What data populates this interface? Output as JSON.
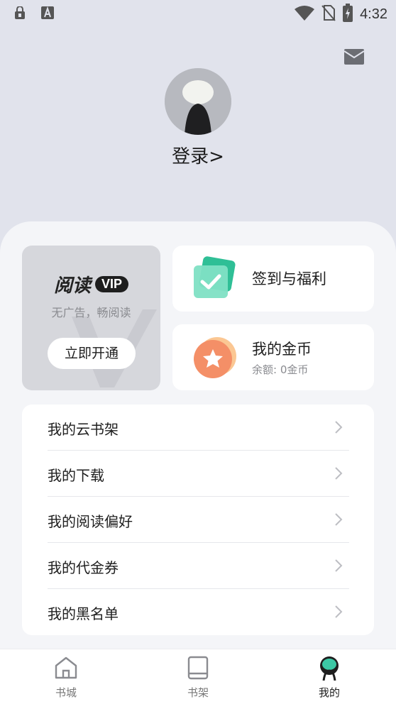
{
  "status_bar": {
    "time": "4:32"
  },
  "profile": {
    "login_label": "登录>"
  },
  "vip": {
    "title": "阅读",
    "badge": "VIP",
    "subtitle": "无广告，畅阅读",
    "button": "立即开通"
  },
  "checkin": {
    "title": "签到与福利"
  },
  "coins": {
    "title": "我的金币",
    "balance": "余额: 0金币"
  },
  "menu": {
    "items": [
      {
        "label": "我的云书架"
      },
      {
        "label": "我的下载"
      },
      {
        "label": "我的阅读偏好"
      },
      {
        "label": "我的代金券"
      },
      {
        "label": "我的黑名单"
      }
    ]
  },
  "tabs": [
    {
      "label": "书城",
      "icon": "home-icon"
    },
    {
      "label": "书架",
      "icon": "book-icon"
    },
    {
      "label": "我的",
      "icon": "profile-icon"
    }
  ],
  "colors": {
    "background": "#e1e3ec",
    "sheet": "#f4f5f8",
    "checkin_accent": "#3fd0a8",
    "coin_accent": "#f59a6c",
    "active_tab_accent": "#3cc8a5"
  }
}
